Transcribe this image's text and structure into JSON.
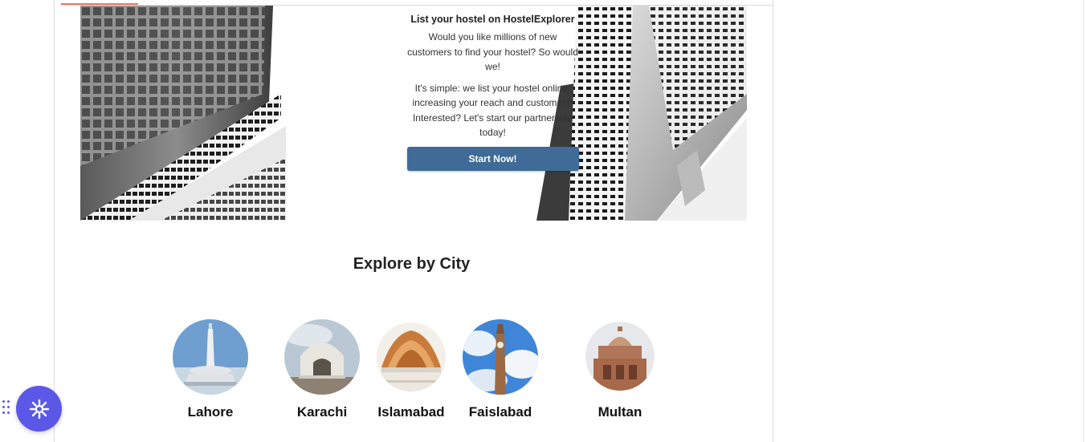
{
  "banner": {
    "title": "List your hostel on HostelExplorer",
    "paragraph1": "Would you like millions of new customers to find your hostel? So would we!",
    "paragraph2": "It's simple: we list your hostel online, increasing your reach and customers! Interested? Let's start our partnership today!",
    "button_label": "Start Now!"
  },
  "explore": {
    "title": "Explore by City",
    "cities": [
      {
        "name": "Lahore"
      },
      {
        "name": "Karachi"
      },
      {
        "name": "Islamabad"
      },
      {
        "name": "Faislabad"
      },
      {
        "name": "Multan"
      }
    ]
  },
  "widget": {
    "icon": "gear-icon",
    "accent_color": "#5b58e8"
  },
  "colors": {
    "button": "#3f6b96",
    "top_accent": "#e77763"
  }
}
